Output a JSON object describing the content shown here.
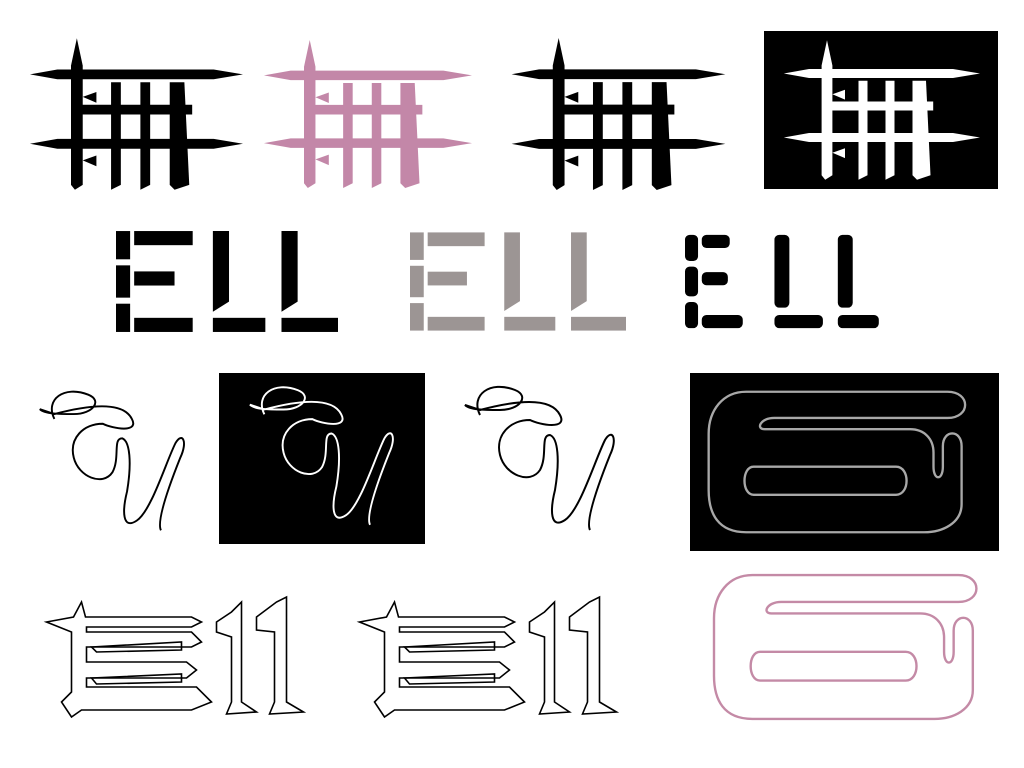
{
  "title": "",
  "colors": {
    "background": "#ffffff",
    "black": "#000000",
    "pink": "#c387a8",
    "gray": "#9c9594",
    "panel": "#000000",
    "outline_gray": "#a8a8a8",
    "outline_pink": "#c48aa6"
  },
  "rows": [
    {
      "name": "spiked-monogram-row",
      "variants": [
        "black",
        "pink",
        "black-alt",
        "white-on-black"
      ]
    },
    {
      "name": "stencil-ell-row",
      "variants": [
        "black",
        "gray",
        "black-rounded"
      ]
    },
    {
      "name": "script-ell-row",
      "variants": [
        "black-line",
        "white-line-on-black",
        "black-line-alt",
        "gray-outline-on-black"
      ]
    },
    {
      "name": "blackletter-outline-row",
      "variants": [
        "black-outline",
        "black-outline-alt",
        "pink-rounded-outline"
      ]
    }
  ]
}
